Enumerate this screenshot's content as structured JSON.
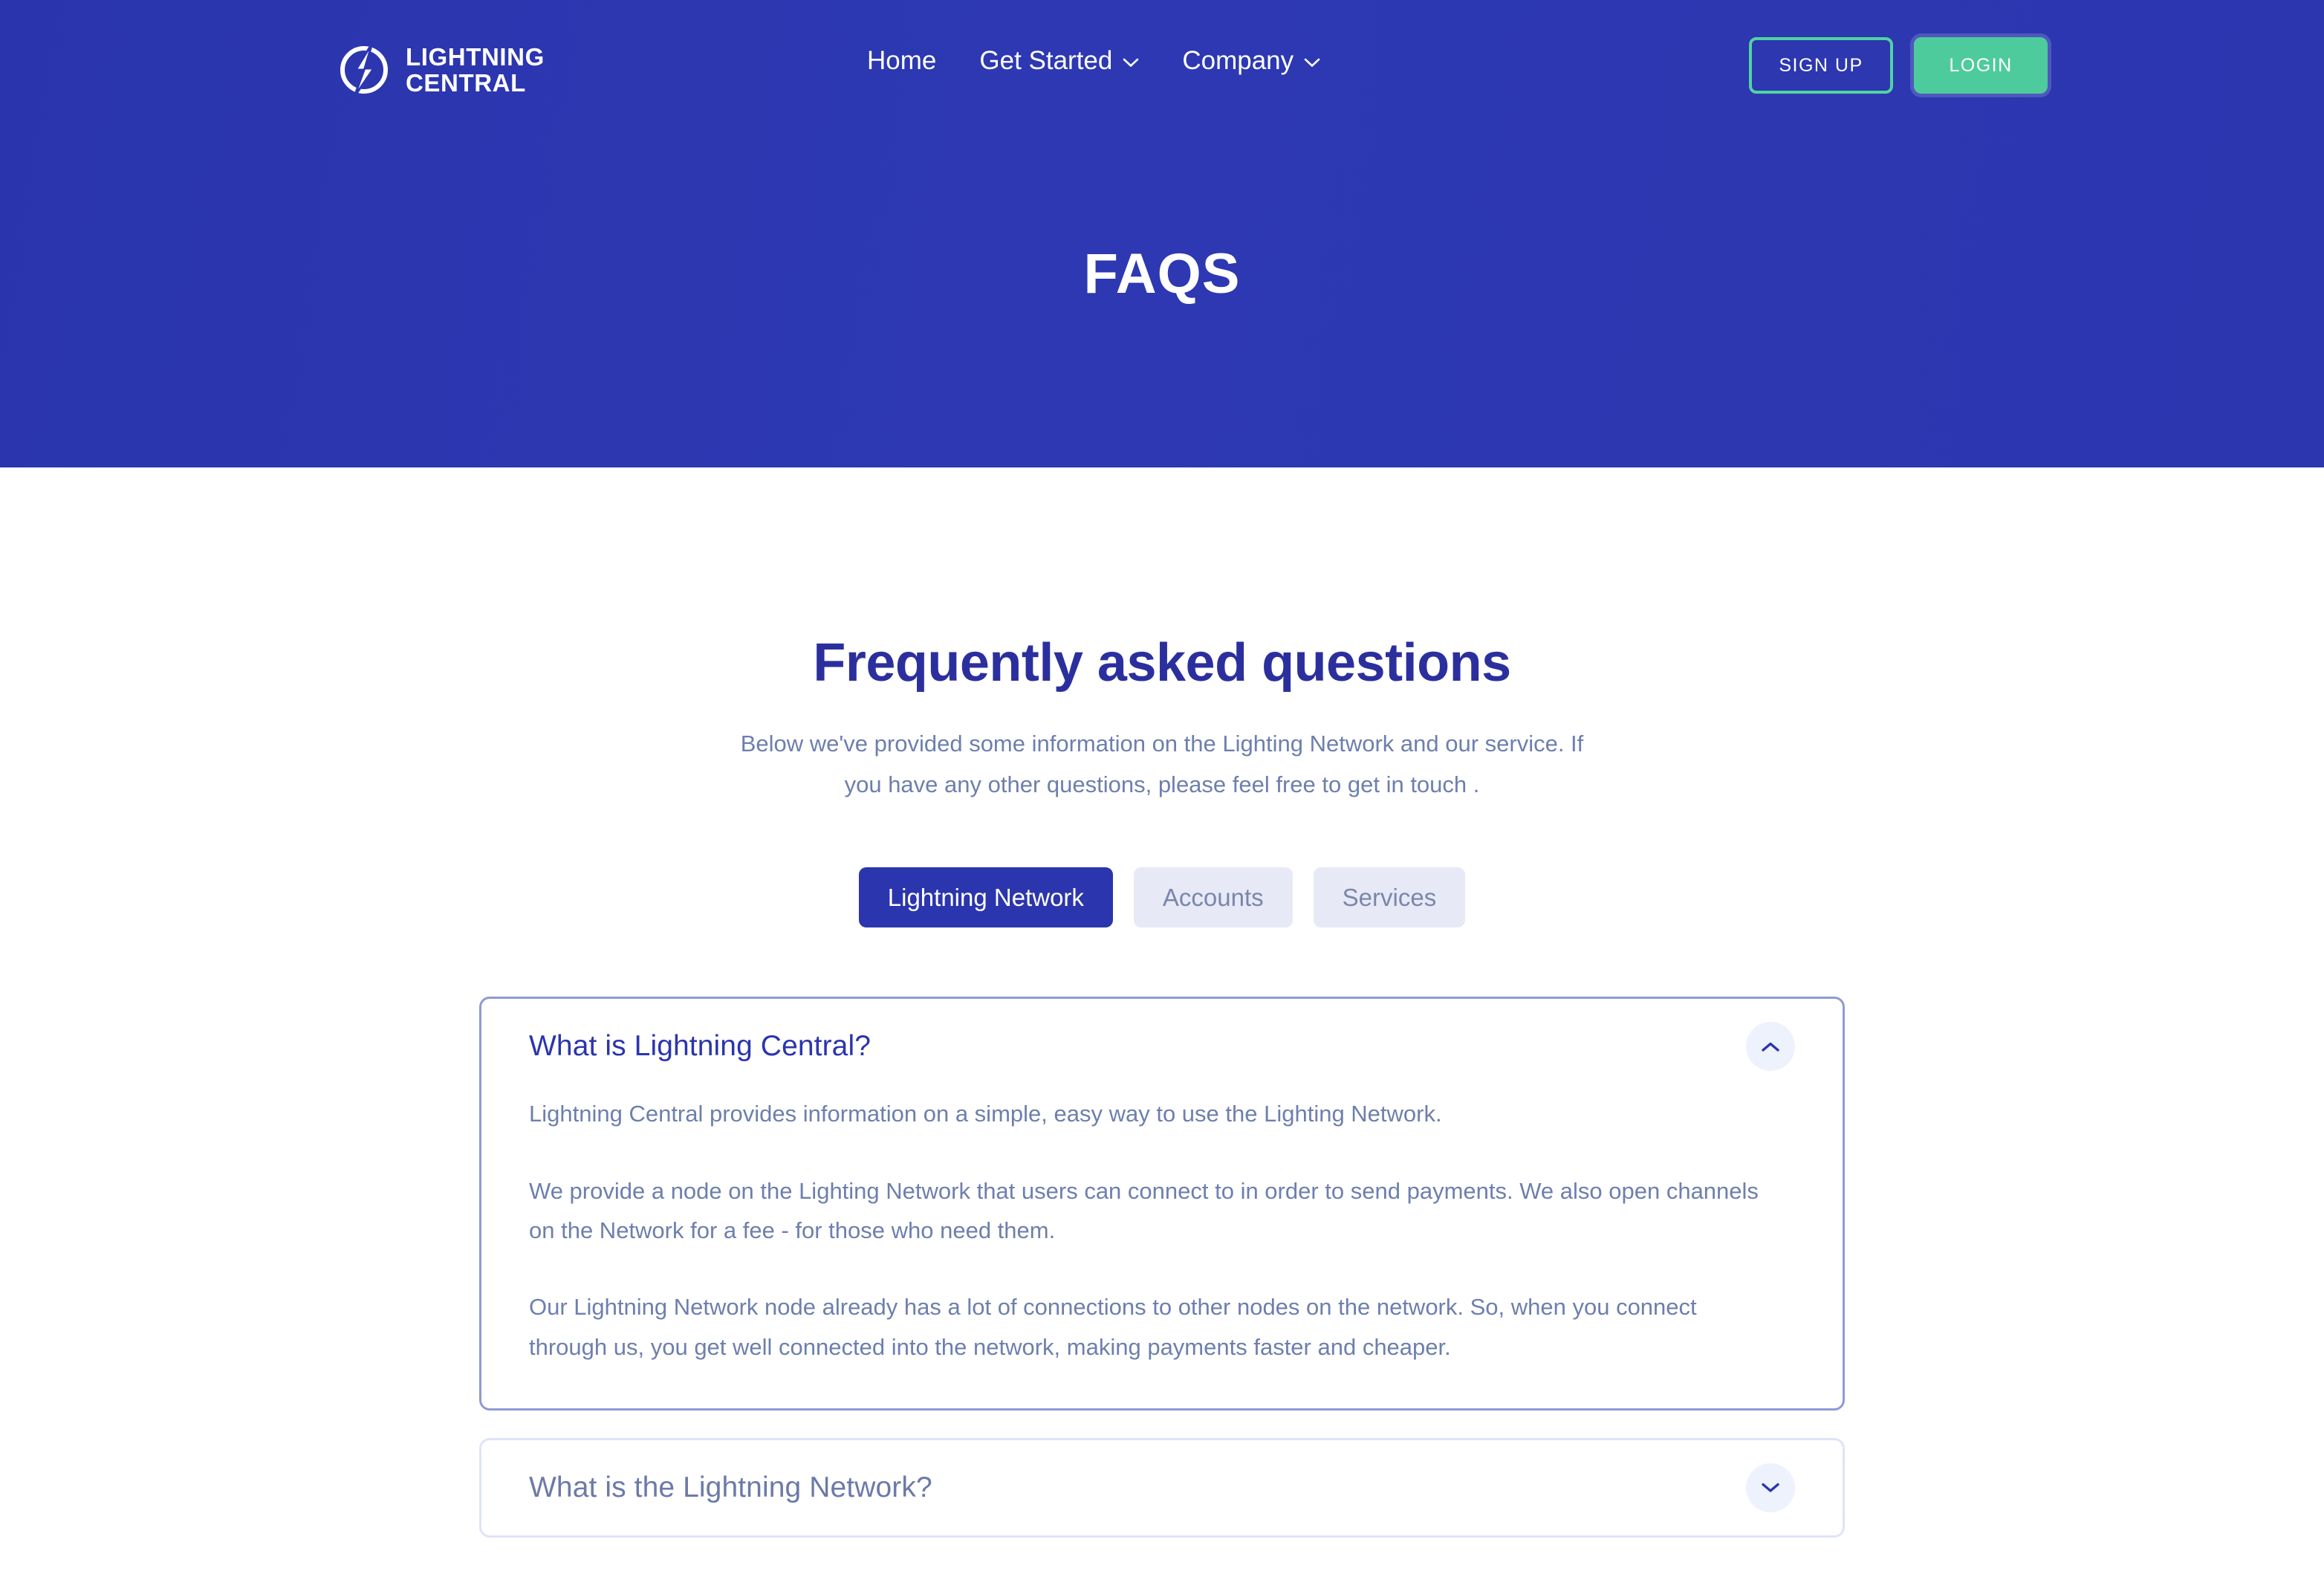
{
  "brand": {
    "logo_icon": "lightning-bolt-circle-icon",
    "name_line1": "LIGHTNING",
    "name_line2": "CENTRAL",
    "name_full": "LIGHTNING\nCENTRAL"
  },
  "nav": {
    "items": [
      {
        "label": "Home",
        "has_dropdown": false
      },
      {
        "label": "Get Started",
        "has_dropdown": true,
        "icon": "chevron-down-icon"
      },
      {
        "label": "Company",
        "has_dropdown": true,
        "icon": "chevron-down-icon"
      }
    ],
    "signup_label": "SIGN UP",
    "login_label": "LOGIN"
  },
  "hero": {
    "title": "FAQS",
    "background_color": "#2b36af"
  },
  "section": {
    "title": "Frequently asked questions",
    "subtitle": "Below we've provided some information on the Lighting Network and our service. If you have any other questions, please feel free to get in touch .",
    "title_color": "#2b2f9e"
  },
  "tabs": [
    {
      "label": "Lightning Network",
      "active": true
    },
    {
      "label": "Accounts",
      "active": false
    },
    {
      "label": "Services",
      "active": false
    }
  ],
  "faqs": [
    {
      "question": "What is Lightning Central?",
      "expanded": true,
      "toggle_icon": "chevron-up-icon",
      "paragraphs": [
        "Lightning Central provides information on a simple, easy way to use the Lighting Network.",
        "We provide a node on the Lighting Network that users can connect to in order to send payments. We also open channels on the Network for a fee - for those who need them.",
        "Our Lightning Network node already has a lot of connections to other nodes on the network. So, when you connect through us, you get well connected into the network, making payments faster and cheaper."
      ]
    },
    {
      "question": "What is the Lightning Network?",
      "expanded": false,
      "toggle_icon": "chevron-down-icon",
      "paragraphs": []
    }
  ],
  "colors": {
    "brand_blue": "#2b35ad",
    "accent_green": "#4ecb9d",
    "muted_text": "#6d7fad",
    "tab_inactive_bg": "#e7e9f6",
    "card_border_open": "#8f99d6",
    "card_border_closed": "#dfe4f7"
  }
}
